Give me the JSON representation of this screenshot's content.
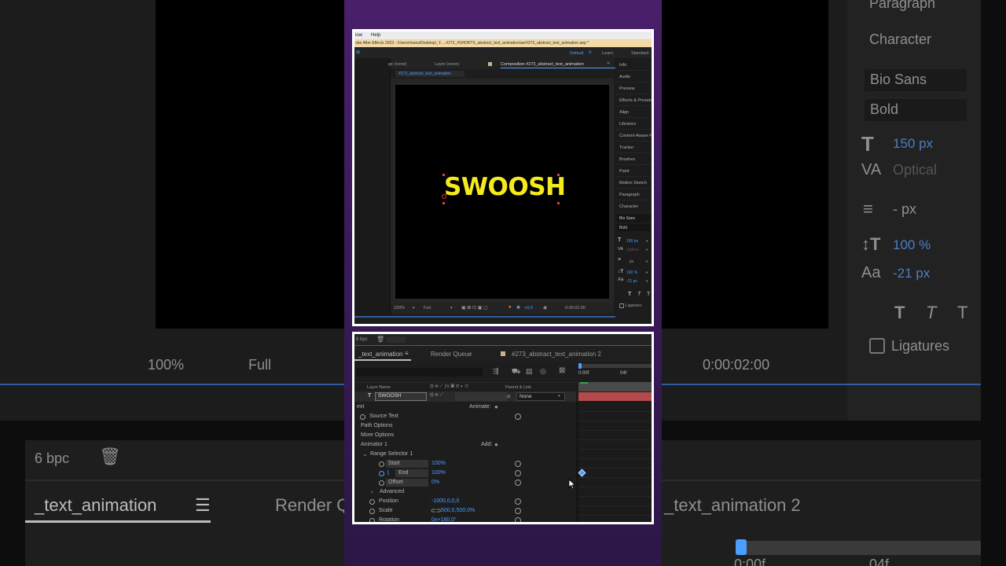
{
  "background": {
    "paragraph": "Paragraph",
    "character": "Character",
    "font_family": "Bio Sans",
    "font_style": "Bold",
    "font_size": "150 px",
    "tracking": "Optical",
    "leading": "- px",
    "vert_scale": "100 %",
    "baseline": "-21 px",
    "ligatures": "Ligatures",
    "zoom": "100%",
    "resolution": "Full",
    "timecode": "0:00:02:00",
    "bpc": "6 bpc",
    "tab_comp": "_text_animation",
    "tab_render": "Render Q",
    "tab_comp2": "_text_animation 2",
    "time_00": "0:00f",
    "time_04": "04f"
  },
  "top": {
    "menu": {
      "view": "iow",
      "help": "Help"
    },
    "app_title": "obe After Effects 2023 - /Users/manu/Desktop/_Y.....#273_#SHORTS_abstract_text_animation/ae/#273_abstract_text_animation.aep *",
    "workspaces": {
      "default": "Default",
      "learn": "Learn",
      "standard": "Standard"
    },
    "panel_tabs": {
      "footage": "ge (none)",
      "layer": "Layer (none)",
      "composition": "Composition #273_abstract_text_animation"
    },
    "comp_subtab": "#273_abstract_text_animation",
    "comp_text": "SWOOSH",
    "footer": {
      "zoom": "100%",
      "res": "Full",
      "exposure": "+0,0",
      "timecode": "0:00:02:00"
    },
    "right_panels": [
      "Info",
      "Audio",
      "Preview",
      "Effects & Presets",
      "Align",
      "Libraries",
      "Content-Aware Fill",
      "Tracker",
      "Brushes",
      "Paint",
      "Motion Sketch",
      "Paragraph",
      "Character"
    ],
    "character": {
      "font": "Bio Sans",
      "style": "Bold",
      "size": "150 px",
      "tracking": "Optical",
      "leading": "px",
      "vscale": "100 %",
      "baseline": "-21 px",
      "ligatures": "Ligatures"
    }
  },
  "timeline": {
    "bpc": "6 bpc",
    "tabs": {
      "comp": "_text_animation",
      "render": "Render Queue",
      "comp2": "#273_abstract_text_animation 2"
    },
    "time_labels": {
      "t0": "0:00f",
      "t4": "04f"
    },
    "col_layer_name": "Layer Name",
    "col_parent": "Parent & Link",
    "layer_name": "SWOOSH",
    "layer_parent": "None",
    "rows": {
      "text": "ext",
      "animate": "Animate:",
      "source_text": "Source Text",
      "path_options": "Path Options",
      "more_options": "More Options",
      "animator": "Animator 1",
      "add": "Add:",
      "range_selector": "Range Selector 1",
      "start": "Start",
      "start_val": "100%",
      "end": "End",
      "end_val": "100%",
      "offset": "Offset",
      "offset_val": "0%",
      "advanced": "Advanced",
      "position": "Position",
      "position_val": "-1000,0,0,0",
      "scale": "Scale",
      "scale_val": "500,0,500,0%",
      "rotation": "Rotation",
      "rotation_val": "0x+180,0°"
    }
  },
  "colors": {
    "accent": "#4a9eff",
    "text_yellow": "#f5ea1c",
    "purple": "#4a1f6b",
    "layer_bar": "#b44a4a"
  }
}
